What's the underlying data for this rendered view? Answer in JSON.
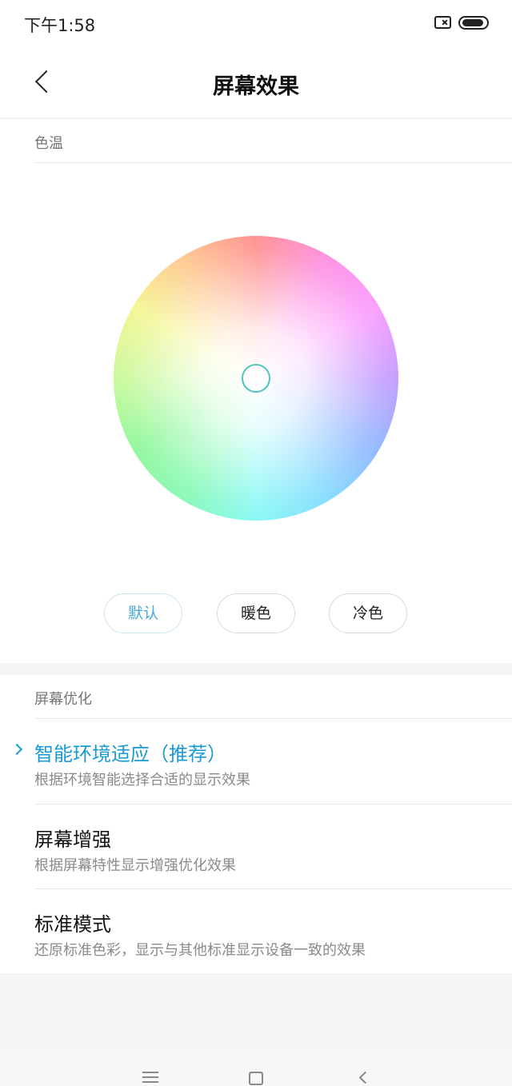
{
  "status_bar": {
    "time": "下午1:58",
    "icons": [
      "sim-icon",
      "battery-icon"
    ]
  },
  "header": {
    "back_icon": "chevron-left-icon",
    "title": "屏幕效果"
  },
  "color_temperature": {
    "section_label": "色温",
    "presets": [
      {
        "label": "默认",
        "active": true
      },
      {
        "label": "暖色",
        "active": false
      },
      {
        "label": "冷色",
        "active": false
      }
    ],
    "accent_color": "#4aa7d6"
  },
  "screen_optimization": {
    "section_label": "屏幕优化",
    "options": [
      {
        "title": "智能环境适应（推荐）",
        "subtitle": "根据环境智能选择合适的显示效果",
        "selected": true
      },
      {
        "title": "屏幕增强",
        "subtitle": "根据屏幕特性显示增强优化效果",
        "selected": false
      },
      {
        "title": "标准模式",
        "subtitle": "还原标准色彩，显示与其他标准显示设备一致的效果",
        "selected": false
      }
    ],
    "selected_color": "#1a9ad2"
  },
  "nav_bar": {
    "icons": [
      "menu-icon",
      "home-icon",
      "back-icon"
    ]
  }
}
